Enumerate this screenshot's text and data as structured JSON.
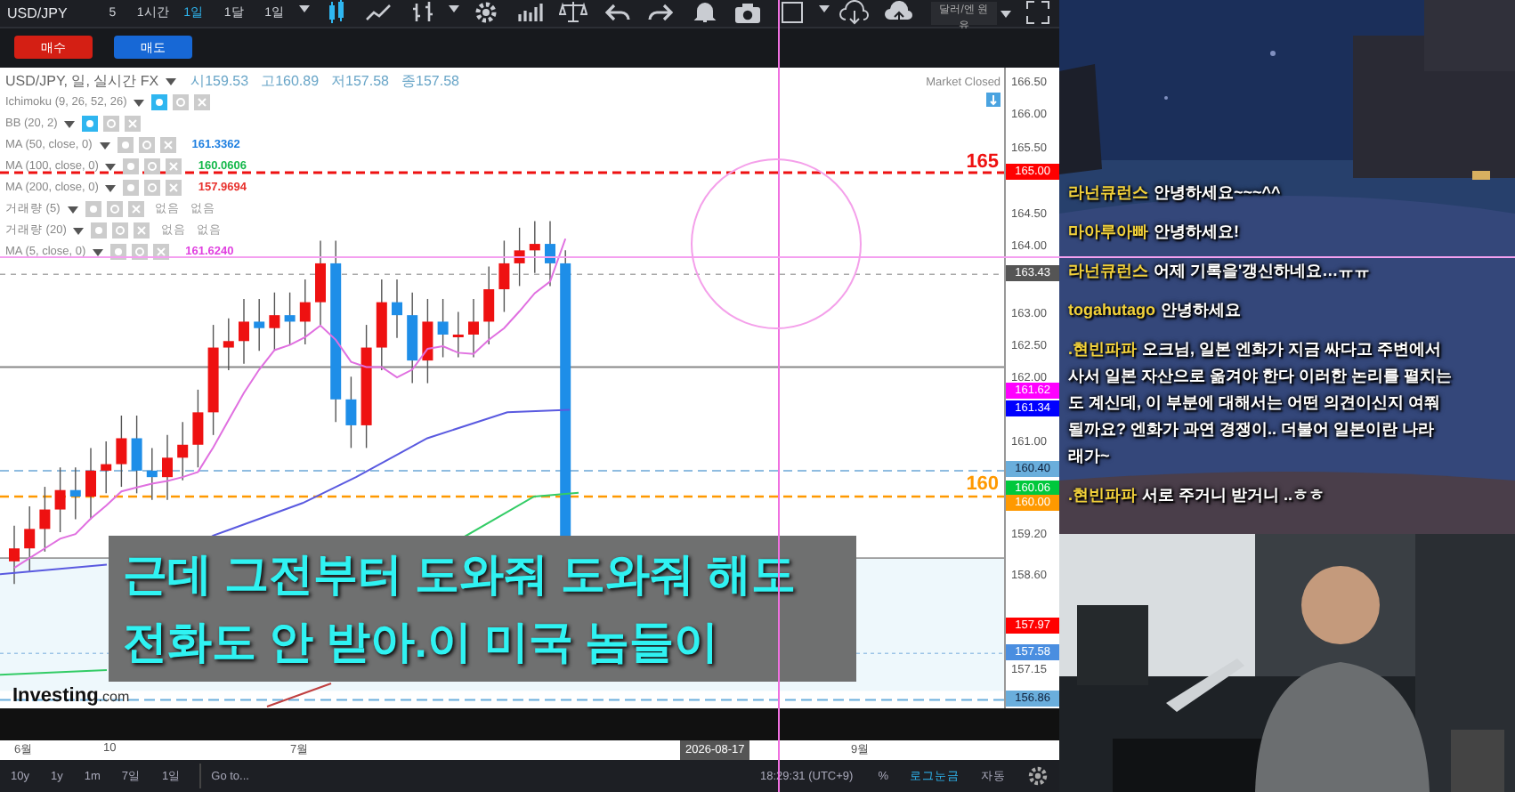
{
  "toolbar": {
    "symbol": "USD/JPY",
    "intervals": [
      {
        "label": "5",
        "selected": false
      },
      {
        "label": "1시간",
        "selected": false
      },
      {
        "label": "1일",
        "selected": true
      },
      {
        "label": "1달",
        "selected": false
      },
      {
        "label": "1일",
        "selected": false
      }
    ],
    "preset": "달러/엔 원유"
  },
  "trade_buttons": [
    {
      "kind": "buy",
      "label": "매수"
    },
    {
      "kind": "sell",
      "label": "매도"
    }
  ],
  "legend": {
    "title": "USD/JPY, 일, 실시간 FX",
    "ohlc": [
      "시159.53",
      "고160.89",
      "저157.58",
      "종157.58"
    ],
    "indicators": [
      {
        "name": "Ichimoku (9, 26, 52, 26)",
        "kind": "visible"
      },
      {
        "name": "BB (20, 2)",
        "kind": "visible"
      },
      {
        "name": "MA (50, close, 0)",
        "kind": "value",
        "value": "161.3362",
        "color": "#1e7fe0"
      },
      {
        "name": "MA (100, close, 0)",
        "kind": "value",
        "value": "160.0606",
        "color": "#14b84a"
      },
      {
        "name": "MA (200, close, 0)",
        "kind": "value",
        "value": "157.9694",
        "color": "#e8322e"
      },
      {
        "name": "거래량 (5)",
        "kind": "volume",
        "values": [
          "없음",
          "없음"
        ]
      },
      {
        "name": "거래량 (20)",
        "kind": "volume",
        "values": [
          "없음",
          "없음"
        ]
      },
      {
        "name": "MA (5, close, 0)",
        "kind": "value",
        "value": "161.6240",
        "color": "#e040e0"
      }
    ]
  },
  "market_status": "Market Closed",
  "level_labels": [
    {
      "text": "165",
      "color": "#ee1111"
    },
    {
      "text": "160",
      "color": "#ff9900"
    }
  ],
  "price_axis": {
    "ticks": [
      "166.50",
      "166.00",
      "165.50",
      "164.50",
      "164.00",
      "163.00",
      "162.50",
      "162.00",
      "161.00",
      "159.20",
      "158.60",
      "157.15"
    ],
    "tags": [
      {
        "text": "165.00",
        "color": "#ff0000"
      },
      {
        "text": "163.43",
        "color": "#555555"
      },
      {
        "text": "161.62",
        "color": "#ff00ff"
      },
      {
        "text": "161.34",
        "color": "#0000ff"
      },
      {
        "text": "160.40",
        "color": "#6aaedc"
      },
      {
        "text": "160.06",
        "color": "#00c83c"
      },
      {
        "text": "160.00",
        "color": "#ff9900"
      },
      {
        "text": "157.97",
        "color": "#ff0000"
      },
      {
        "text": "157.58",
        "color": "#4a8ee0"
      },
      {
        "text": "156.86",
        "color": "#6aaedc"
      }
    ]
  },
  "time_axis": {
    "labels": [
      "6월",
      "10",
      "7월",
      "9월"
    ],
    "cursor_date": "2026-08-17"
  },
  "brand": {
    "name": "Investing",
    "suffix": ".com"
  },
  "bottom_bar": {
    "ranges": [
      "10y",
      "1y",
      "1m",
      "7일",
      "1일"
    ],
    "goto": "Go to...",
    "clock": "18:29:31 (UTC+9)",
    "options": [
      "%",
      "로그눈금",
      "자동"
    ]
  },
  "subtitle": [
    "근데 그전부터 도와줘 도와줘 해도",
    "전화도 안 받아.이 미국 놈들이"
  ],
  "chat": [
    {
      "user": "라넌큐런스",
      "lines": [
        "안녕하세요~~~^^"
      ]
    },
    {
      "user": "마아루아빠",
      "lines": [
        "안녕하세요!"
      ]
    },
    {
      "user": "라넌큐런스",
      "lines": [
        "어제 기록을'갱신하네요…ㅠㅠ"
      ]
    },
    {
      "user": "togahutago",
      "lines": [
        "안녕하세요"
      ]
    },
    {
      "user": ".현빈파파",
      "lines": [
        "오크님, 일본 엔화가 지금 싸다고 주변에서",
        "사서 일본 자산으로 옮겨야 한다 이러한 논리를 펼치는",
        "도 계신데, 이 부분에 대해서는 어떤 의견이신지 여쭤",
        "될까요? 엔화가 과연 경쟁이.. 더불어 일본이란 나라",
        "래가~"
      ]
    },
    {
      "user": ".현빈파파",
      "lines": [
        "서로 주거니 받거니 ..ㅎㅎ"
      ]
    }
  ]
}
